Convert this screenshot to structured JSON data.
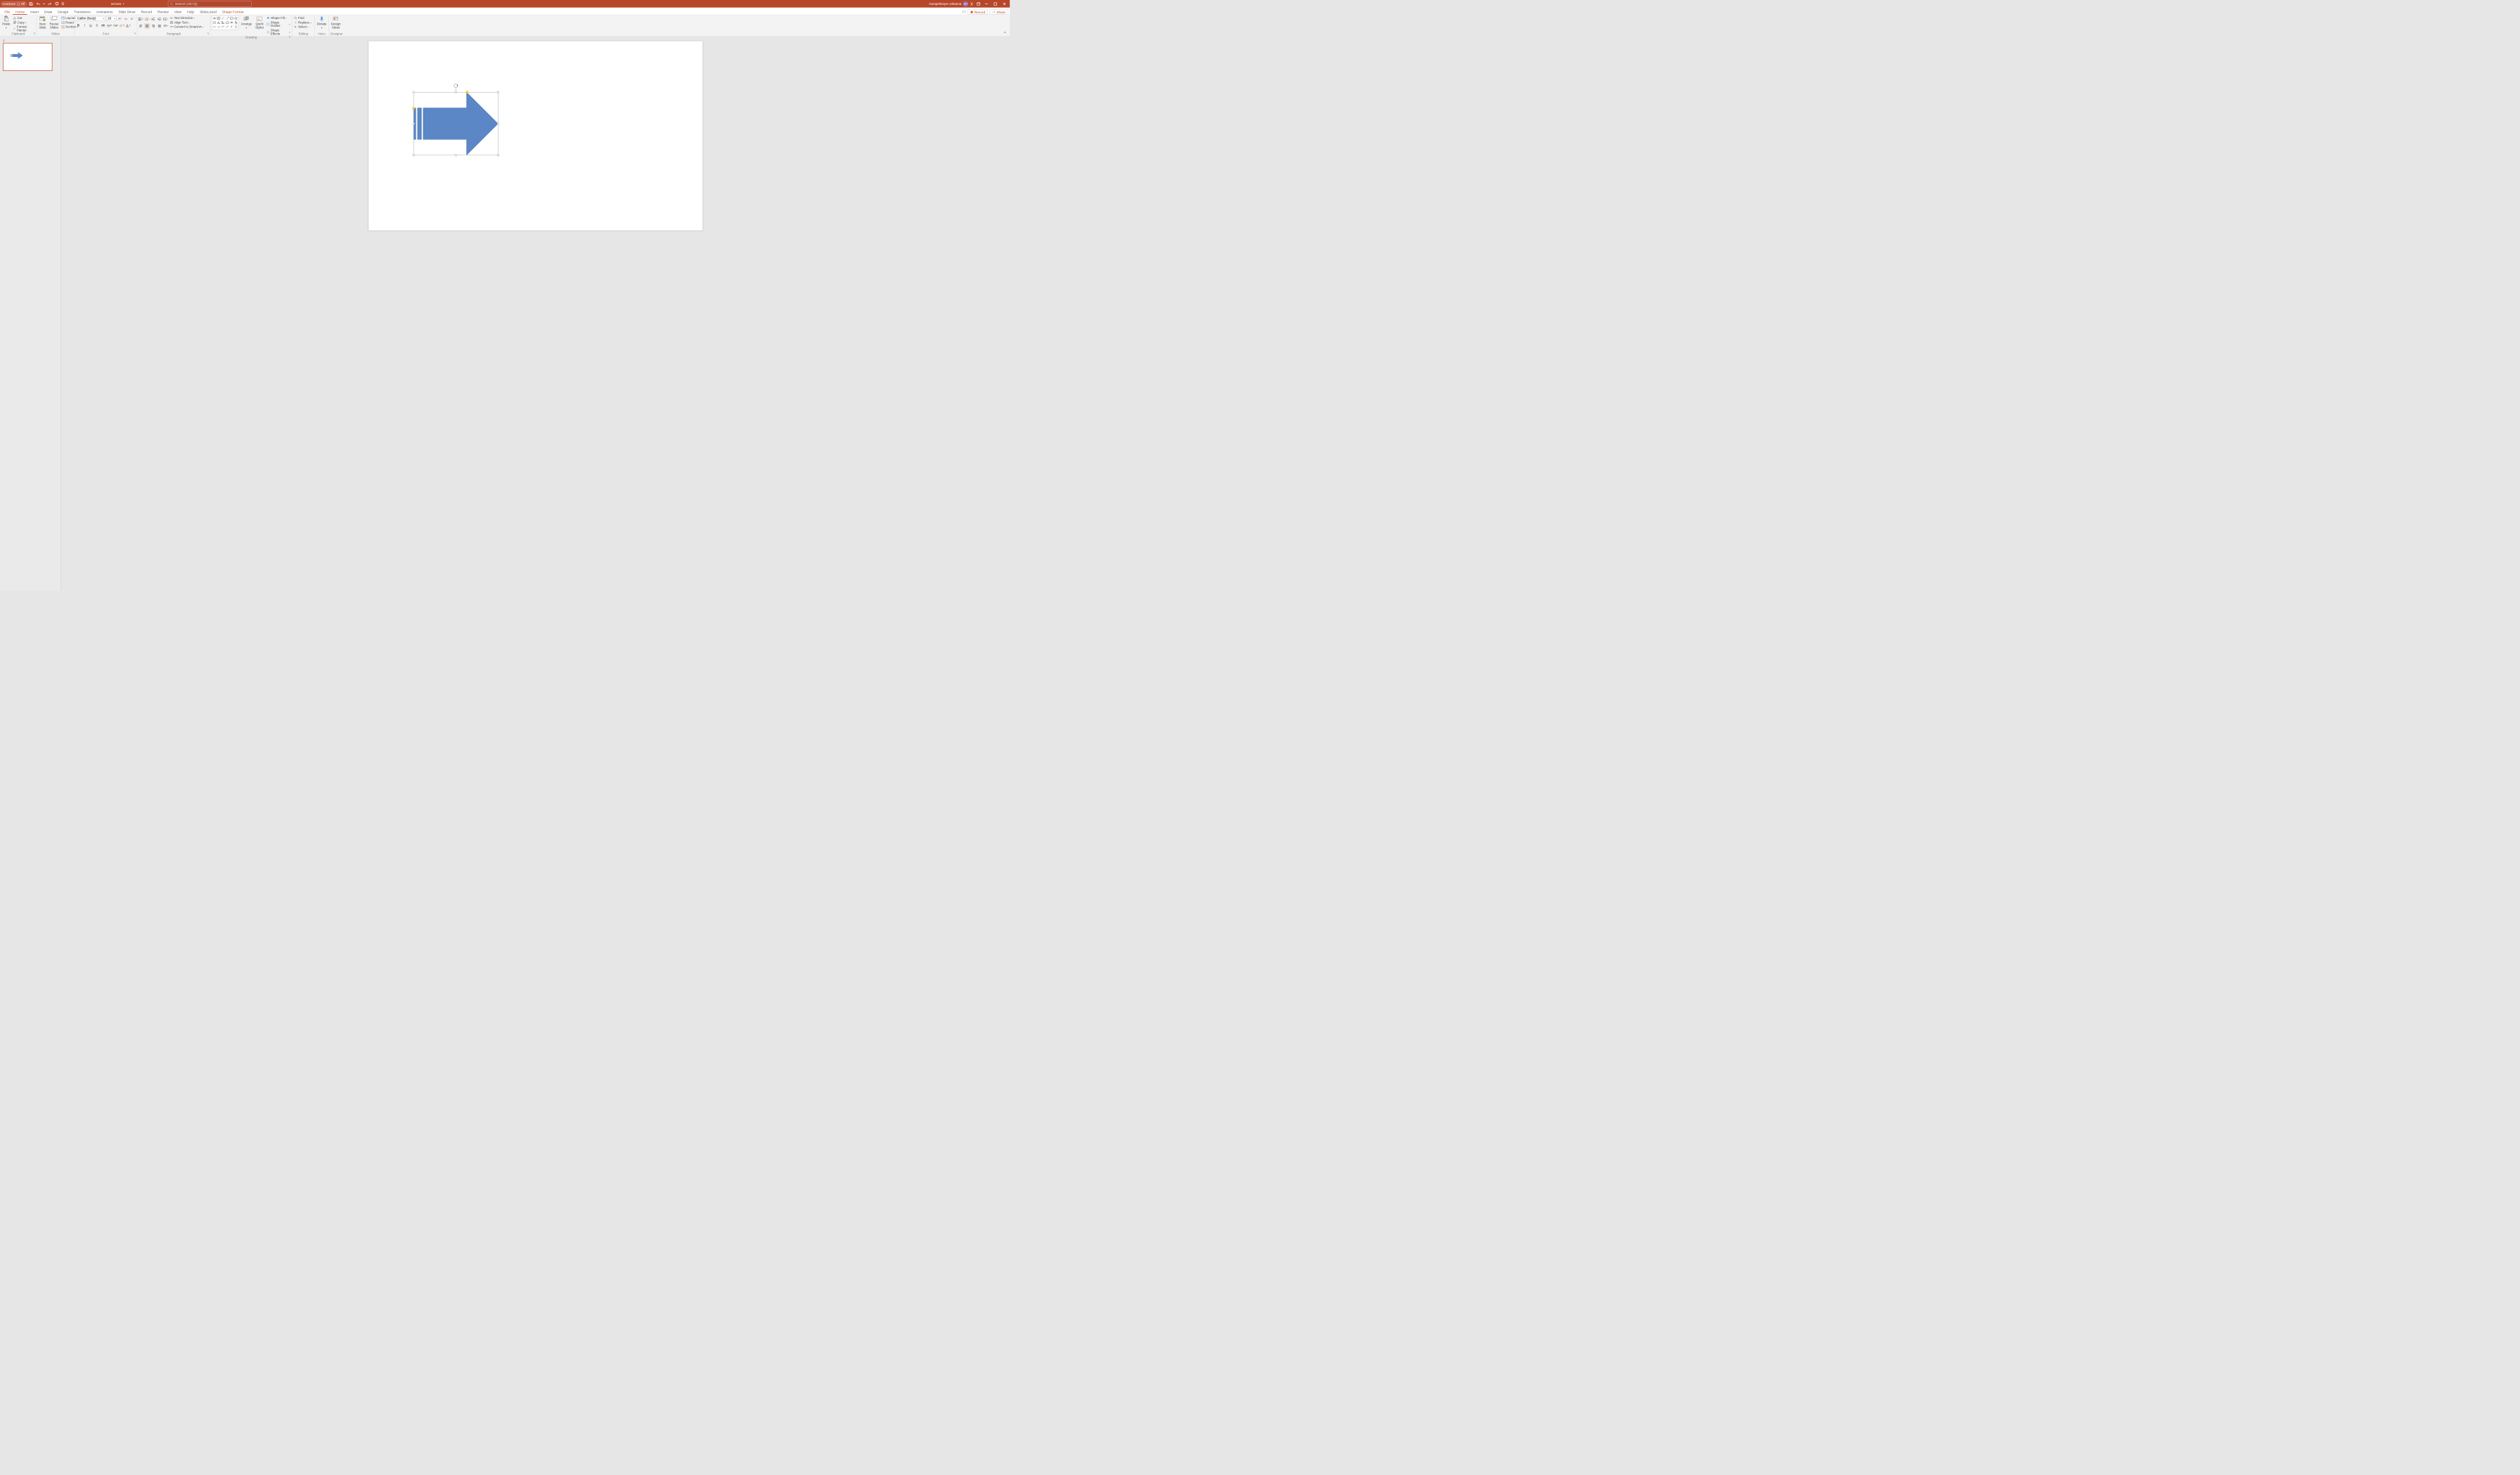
{
  "titlebar": {
    "autosave_label": "AutoSave",
    "autosave_state": "Off",
    "doc_name": "arrows",
    "search_placeholder": "Search (Alt+Q)",
    "user_name": "Gumpelmeyer Johanna",
    "user_initials": "GJ"
  },
  "tabs": {
    "file": "File",
    "home": "Home",
    "insert": "Insert",
    "draw": "Draw",
    "design": "Design",
    "transitions": "Transitions",
    "animations": "Animations",
    "slideshow": "Slide Show",
    "record": "Record",
    "review": "Review",
    "view": "View",
    "help": "Help",
    "slidelizard": "SlideLizard",
    "shapeformat": "Shape Format",
    "record_btn": "Record",
    "share_btn": "Share"
  },
  "ribbon": {
    "clipboard": {
      "paste": "Paste",
      "cut": "Cut",
      "copy": "Copy",
      "format_painter": "Format Painter",
      "group": "Clipboard"
    },
    "slides": {
      "new_slide": "New\nSlide",
      "reuse_slides": "Reuse\nSlides",
      "layout": "Layout",
      "reset": "Reset",
      "section": "Section",
      "group": "Slides"
    },
    "font": {
      "name": "Calibri (Body)",
      "size": "18",
      "group": "Font",
      "bold": "B",
      "italic": "I",
      "underline": "U",
      "strike": "S",
      "spacing": "AV",
      "case": "Aa"
    },
    "paragraph": {
      "text_direction": "Text Direction",
      "align_text": "Align Text",
      "convert_smartart": "Convert to SmartArt",
      "group": "Paragraph"
    },
    "drawing": {
      "arrange": "Arrange",
      "quick_styles": "Quick\nStyles",
      "shape_fill": "Shape Fill",
      "shape_outline": "Shape Outline",
      "shape_effects": "Shape Effects",
      "group": "Drawing"
    },
    "editing": {
      "find": "Find",
      "replace": "Replace",
      "select": "Select",
      "group": "Editing"
    },
    "voice": {
      "dictate": "Dictate",
      "group": "Voice"
    },
    "designer": {
      "design_ideas": "Design\nIdeas",
      "group": "Designer"
    }
  },
  "slide": {
    "number": "1",
    "arrow_color": "#5b87c7",
    "accent_color": "#b7472a"
  }
}
